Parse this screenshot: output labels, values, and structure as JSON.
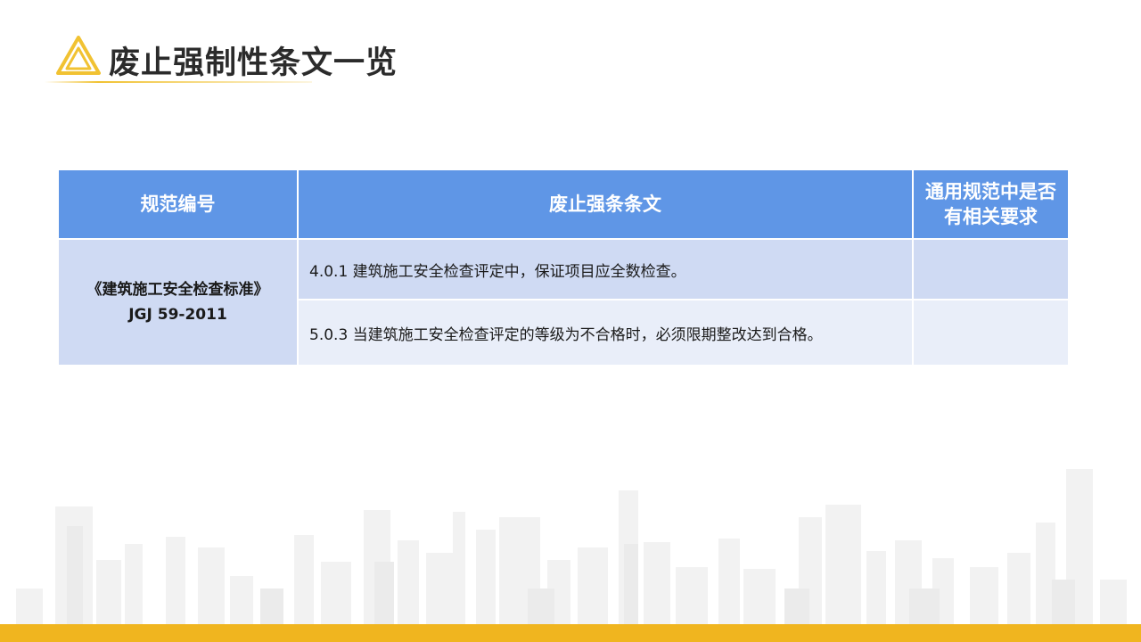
{
  "header": {
    "title": "废止强制性条文一览",
    "icon": "triangle-logo-icon",
    "accent_color": "#f1c232"
  },
  "table": {
    "header_color": "#5f96e6",
    "columns": [
      "规范编号",
      "废止强条条文",
      "通用规范中是否有相关要求"
    ],
    "rows": [
      {
        "code_line1": "《建筑施工安全检查标准》",
        "code_line2": "JGJ 59-2011",
        "clauses": [
          {
            "text": "4.0.1 建筑施工安全检查评定中，保证项目应全数检查。",
            "general": ""
          },
          {
            "text": "5.0.3 当建筑施工安全检查评定的等级为不合格时，必须限期整改达到合格。",
            "general": ""
          }
        ]
      }
    ]
  },
  "decor": {
    "background_graphic": "city-skyline-icon",
    "bottom_bar_color": "#f0b51f"
  }
}
